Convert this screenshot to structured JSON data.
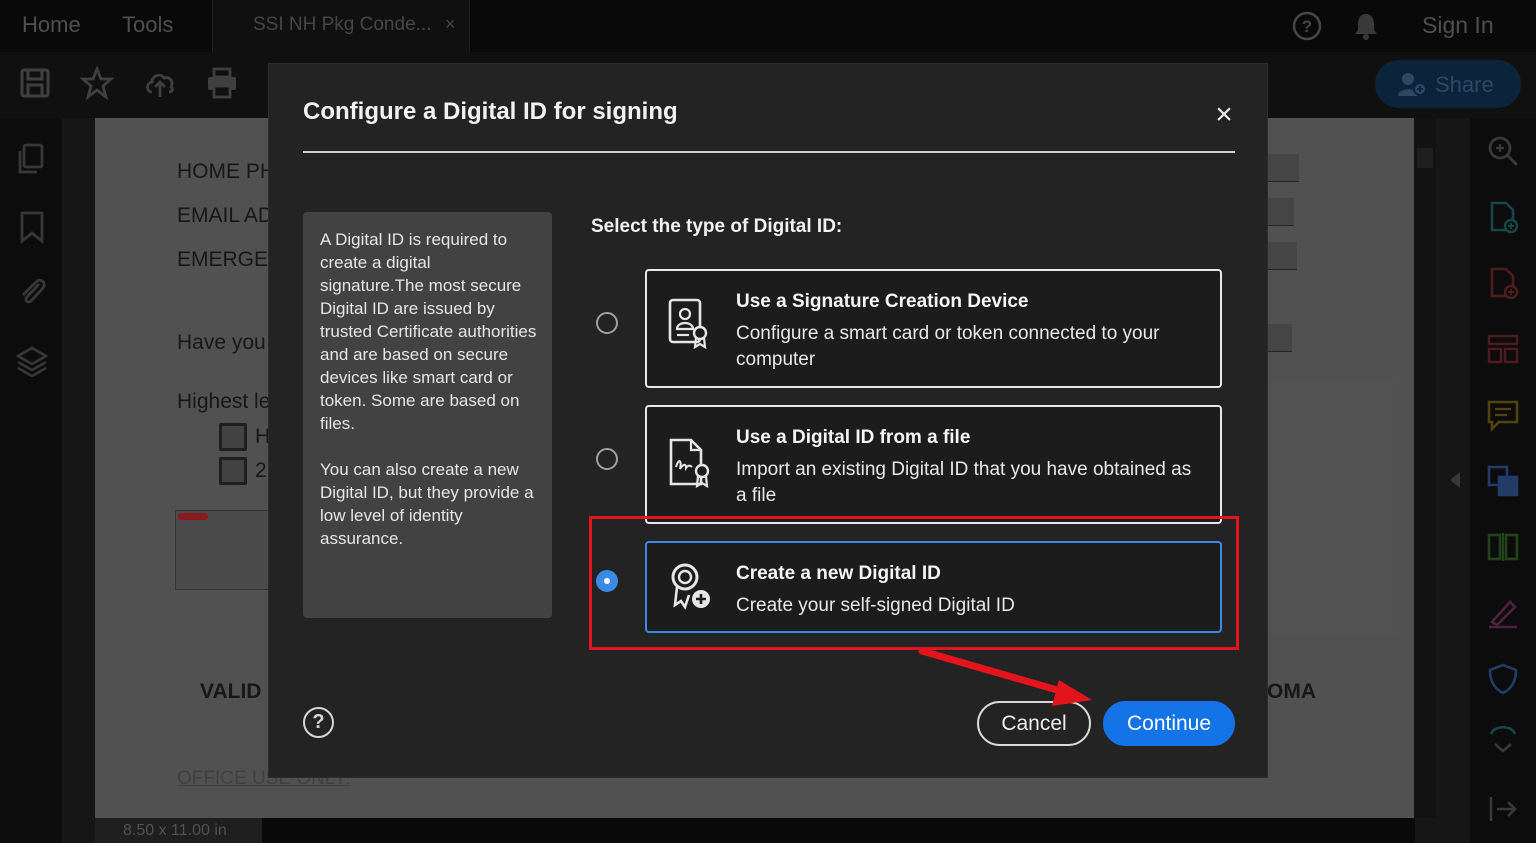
{
  "topbar": {
    "home": "Home",
    "tools": "Tools",
    "doc_tab": "SSI NH Pkg Conde...",
    "doc_tab_close": "×",
    "sign_in": "Sign In"
  },
  "toolbar": {
    "share": "Share"
  },
  "document": {
    "labels": [
      "HOME PH",
      "EMAIL AD",
      "EMERGEN",
      "Have you",
      "Highest le",
      "H",
      "2",
      "VALID",
      "OMA",
      "OFFICE USE ONLY:"
    ],
    "page_size": "8.50 x 11.00 in"
  },
  "dialog": {
    "title": "Configure a Digital ID for signing",
    "close": "×",
    "info_para1": "A Digital ID is required to create a digital signature.The most secure Digital ID are issued by trusted Certificate authorities and are based on secure devices like smart card or token. Some are based on files.",
    "info_para2": "You can also create a new Digital ID, but they provide a low level of identity assurance.",
    "select_heading": "Select the type of Digital ID:",
    "options": [
      {
        "title": "Use a Signature Creation Device",
        "desc": "Configure a smart card or token connected to your computer",
        "icon": "certificate-device-icon",
        "selected": false
      },
      {
        "title": "Use a Digital ID from a file",
        "desc": "Import an existing Digital ID that you have obtained as a file",
        "icon": "signature-file-icon",
        "selected": false
      },
      {
        "title": "Create a new Digital ID",
        "desc": "Create your self-signed Digital ID",
        "icon": "new-id-badge-icon",
        "selected": true
      }
    ],
    "help": "?",
    "cancel": "Cancel",
    "continue": "Continue"
  },
  "colors": {
    "accent": "#1473e6",
    "selected_border": "#3a8ae6",
    "annotation_red": "#e3141b"
  }
}
